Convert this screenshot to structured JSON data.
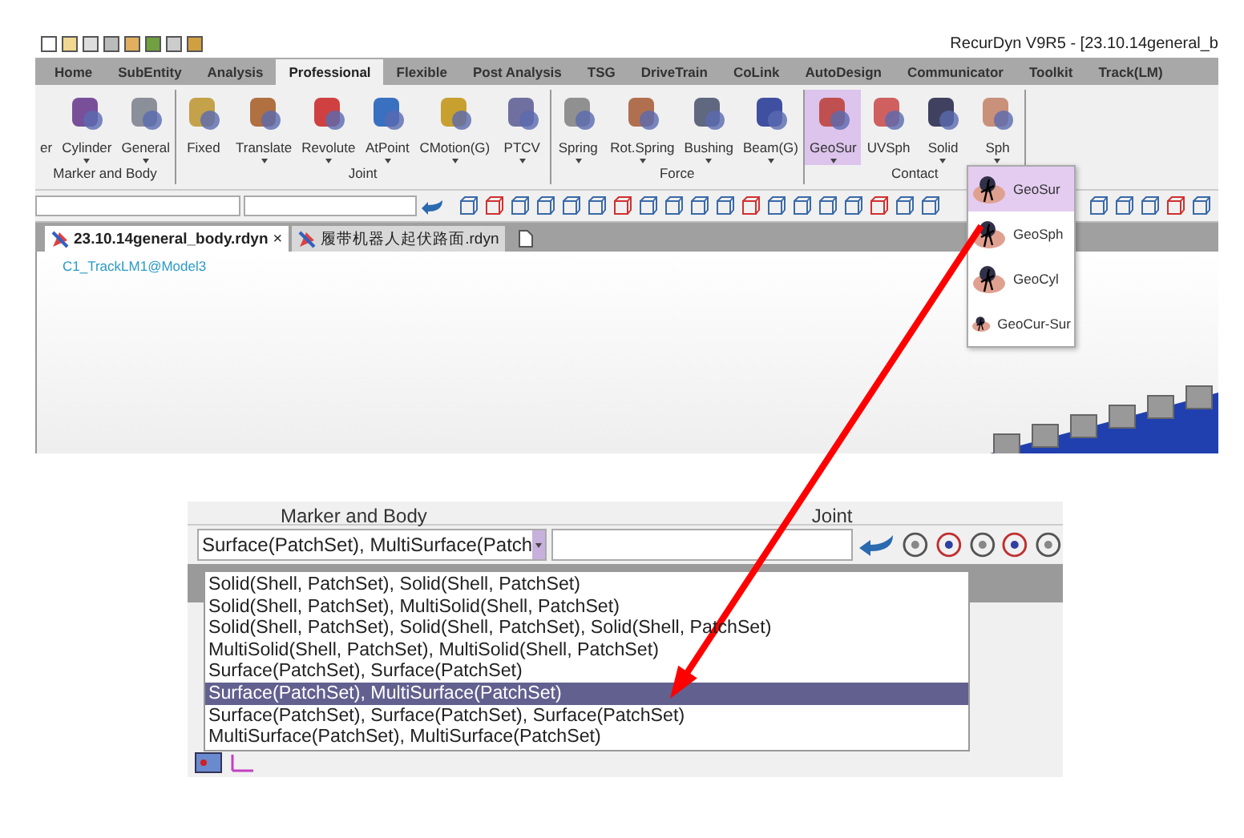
{
  "top_screenshot": {
    "title": "RecurDyn V9R5  - [23.10.14general_b",
    "ribbon_tabs": [
      {
        "label": "Home",
        "selected": false
      },
      {
        "label": "SubEntity",
        "selected": false
      },
      {
        "label": "Analysis",
        "selected": false
      },
      {
        "label": "Professional",
        "selected": true
      },
      {
        "label": "Flexible",
        "selected": false
      },
      {
        "label": "Post Analysis",
        "selected": false
      },
      {
        "label": "TSG",
        "selected": false
      },
      {
        "label": "DriveTrain",
        "selected": false
      },
      {
        "label": "CoLink",
        "selected": false
      },
      {
        "label": "AutoDesign",
        "selected": false
      },
      {
        "label": "Communicator",
        "selected": false
      },
      {
        "label": "Toolkit",
        "selected": false
      },
      {
        "label": "Track(LM)",
        "selected": false
      }
    ],
    "ribbon_groups": [
      {
        "label": "Marker and Body",
        "buttons": [
          {
            "label": "er",
            "kind": "partial",
            "dropdown": false,
            "selected": false
          },
          {
            "label": "Cylinder",
            "kind": "tool",
            "dropdown": true,
            "selected": false
          },
          {
            "label": "General",
            "kind": "tool",
            "dropdown": true,
            "selected": false
          }
        ]
      },
      {
        "label": "Joint",
        "buttons": [
          {
            "label": "Fixed",
            "kind": "tool",
            "dropdown": false,
            "selected": false
          },
          {
            "label": "Translate",
            "kind": "tool",
            "dropdown": true,
            "selected": false
          },
          {
            "label": "Revolute",
            "kind": "tool",
            "dropdown": true,
            "selected": false
          },
          {
            "label": "AtPoint",
            "kind": "tool",
            "dropdown": true,
            "selected": false
          },
          {
            "label": "CMotion(G)",
            "kind": "tool",
            "dropdown": true,
            "selected": false
          },
          {
            "label": "PTCV",
            "kind": "tool",
            "dropdown": true,
            "selected": false
          }
        ]
      },
      {
        "label": "Force",
        "buttons": [
          {
            "label": "Spring",
            "kind": "tool",
            "dropdown": true,
            "selected": false
          },
          {
            "label": "Rot.Spring",
            "kind": "tool",
            "dropdown": true,
            "selected": false
          },
          {
            "label": "Bushing",
            "kind": "tool",
            "dropdown": true,
            "selected": false
          },
          {
            "label": "Beam(G)",
            "kind": "tool",
            "dropdown": true,
            "selected": false
          }
        ]
      },
      {
        "label": "Contact",
        "buttons": [
          {
            "label": "GeoSur",
            "kind": "tool",
            "dropdown": true,
            "selected": true
          },
          {
            "label": "UVSph",
            "kind": "tool",
            "dropdown": false,
            "selected": false
          },
          {
            "label": "Solid",
            "kind": "tool",
            "dropdown": true,
            "selected": false
          },
          {
            "label": "Sph",
            "kind": "tool",
            "dropdown": true,
            "selected": false
          }
        ]
      }
    ],
    "document_tabs": [
      {
        "label": "23.10.14general_body.rdyn",
        "selected": true,
        "close": "×"
      },
      {
        "label": "履带机器人起伏路面.rdyn",
        "selected": false
      }
    ],
    "canvas_label": "C1_TrackLM1@Model3",
    "geo_menu": [
      {
        "label": "GeoSur",
        "selected": true
      },
      {
        "label": "GeoSph",
        "selected": false
      },
      {
        "label": "GeoCyl",
        "selected": false
      },
      {
        "label": "GeoCur-Sur",
        "selected": false
      }
    ]
  },
  "bottom_screenshot": {
    "group_labels": [
      "Marker and Body",
      "Joint"
    ],
    "combo": {
      "value": "Surface(PatchSet), MultiSurface(Patch"
    },
    "options": [
      {
        "label": "Solid(Shell, PatchSet), Solid(Shell, PatchSet)",
        "selected": false
      },
      {
        "label": "Solid(Shell, PatchSet), MultiSolid(Shell, PatchSet)",
        "selected": false
      },
      {
        "label": "Solid(Shell, PatchSet), Solid(Shell, PatchSet), Solid(Shell, PatchSet)",
        "selected": false
      },
      {
        "label": "MultiSolid(Shell, PatchSet), MultiSolid(Shell, PatchSet)",
        "selected": false
      },
      {
        "label": "Surface(PatchSet), Surface(PatchSet)",
        "selected": false
      },
      {
        "label": "Surface(PatchSet), MultiSurface(PatchSet)",
        "selected": true
      },
      {
        "label": "Surface(PatchSet), Surface(PatchSet), Surface(PatchSet)",
        "selected": false
      },
      {
        "label": "MultiSurface(PatchSet), MultiSurface(PatchSet)",
        "selected": false
      }
    ]
  }
}
